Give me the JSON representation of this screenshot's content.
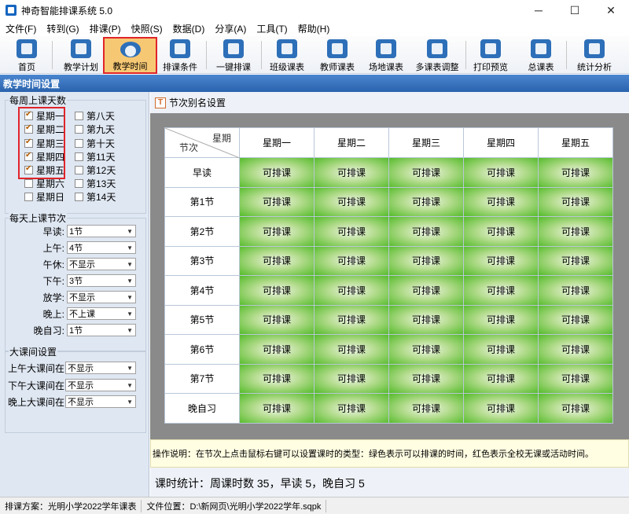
{
  "window": {
    "title": "神奇智能排课系统 5.0",
    "minimize": "─",
    "maximize": "☐",
    "close": "✕"
  },
  "menu": [
    "文件(F)",
    "转到(G)",
    "排课(P)",
    "快照(S)",
    "数据(D)",
    "分享(A)",
    "工具(T)",
    "帮助(H)"
  ],
  "toolbar": [
    {
      "label": "首页",
      "icon": "home-icon"
    },
    {
      "label": "教学计划",
      "icon": "clipboard-icon"
    },
    {
      "label": "教学时间",
      "icon": "clock-icon",
      "active": true
    },
    {
      "label": "排课条件",
      "icon": "conditions-icon"
    },
    {
      "label": "一键排课",
      "icon": "click-icon"
    },
    {
      "label": "班级课表",
      "icon": "class-schedule-icon"
    },
    {
      "label": "教师课表",
      "icon": "teacher-schedule-icon"
    },
    {
      "label": "场地课表",
      "icon": "venue-schedule-icon"
    },
    {
      "label": "多课表调整",
      "icon": "multi-adjust-icon"
    },
    {
      "label": "打印预览",
      "icon": "print-icon"
    },
    {
      "label": "总课表",
      "icon": "master-schedule-icon"
    },
    {
      "label": "统计分析",
      "icon": "chart-icon"
    }
  ],
  "section_title": "教学时间设置",
  "days_group": {
    "title": "每周上课天数",
    "left": [
      {
        "label": "星期一",
        "checked": true
      },
      {
        "label": "星期二",
        "checked": true
      },
      {
        "label": "星期三",
        "checked": true
      },
      {
        "label": "星期四",
        "checked": true
      },
      {
        "label": "星期五",
        "checked": true
      },
      {
        "label": "星期六",
        "checked": false
      },
      {
        "label": "星期日",
        "checked": false
      }
    ],
    "right": [
      {
        "label": "第八天",
        "checked": false
      },
      {
        "label": "第九天",
        "checked": false
      },
      {
        "label": "第十天",
        "checked": false
      },
      {
        "label": "第11天",
        "checked": false
      },
      {
        "label": "第12天",
        "checked": false
      },
      {
        "label": "第13天",
        "checked": false
      },
      {
        "label": "第14天",
        "checked": false
      }
    ]
  },
  "periods_group": {
    "title": "每天上课节次",
    "rows": [
      {
        "label": "早读:",
        "value": "1节"
      },
      {
        "label": "上午:",
        "value": "4节"
      },
      {
        "label": "午休:",
        "value": "不显示"
      },
      {
        "label": "下午:",
        "value": "3节"
      },
      {
        "label": "放学:",
        "value": "不显示"
      },
      {
        "label": "晚上:",
        "value": "不上课"
      },
      {
        "label": "晚自习:",
        "value": "1节"
      }
    ]
  },
  "break_group": {
    "title": "大课间设置",
    "rows": [
      {
        "label": "上午大课间在:",
        "value": "不显示"
      },
      {
        "label": "下午大课间在:",
        "value": "不显示"
      },
      {
        "label": "晚上大课间在:",
        "value": "不显示"
      }
    ]
  },
  "subtoolbar": {
    "label": "节次别名设置"
  },
  "grid": {
    "corner_top": "星期",
    "corner_bottom": "节次",
    "days": [
      "星期一",
      "星期二",
      "星期三",
      "星期四",
      "星期五"
    ],
    "periods": [
      "早读",
      "第1节",
      "第2节",
      "第3节",
      "第4节",
      "第5节",
      "第6节",
      "第7节",
      "晚自习"
    ],
    "cell_text": "可排课",
    "cell_color": "#58bc2e"
  },
  "note": "操作说明：在节次上点击鼠标右键可以设置课时的类型：绿色表示可以排课的时间，红色表示全校无课或活动时间。",
  "stats": "课时统计：周课时数 35，早读 5，晚自习 5",
  "status": {
    "scheme": "排课方案：光明小学2022学年课表",
    "file": "文件位置：D:\\新网页\\光明小学2022学年.sqpk"
  }
}
